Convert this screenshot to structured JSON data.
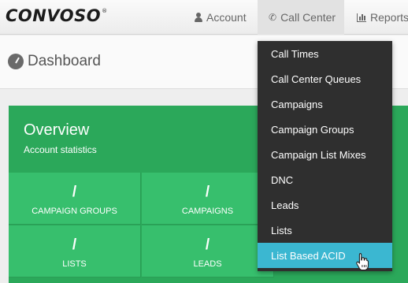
{
  "brand": {
    "logo": "CONVOSO",
    "mark": "®"
  },
  "nav": {
    "account": "Account",
    "call_center": "Call Center",
    "reports": "Reports"
  },
  "page": {
    "title": "Dashboard"
  },
  "overview": {
    "title": "Overview",
    "subtitle": "Account statistics",
    "tiles": [
      {
        "value": "/",
        "label": "CAMPAIGN GROUPS"
      },
      {
        "value": "/",
        "label": "CAMPAIGNS"
      },
      {
        "value": "/",
        "label": "LISTS"
      },
      {
        "value": "/",
        "label": "LEADS"
      }
    ]
  },
  "dropdown": {
    "items": [
      "Call Times",
      "Call Center Queues",
      "Campaigns",
      "Campaign Groups",
      "Campaign List Mixes",
      "DNC",
      "Leads",
      "Lists",
      "List Based ACID"
    ],
    "hovered_index": 8
  },
  "colors": {
    "panel_green": "#2ba85a",
    "tile_green": "#37bf6d",
    "menu_dark": "#2f2f2f",
    "menu_hover": "#3bb7d1"
  },
  "icons": {
    "account": "user-icon",
    "call_center": "phone-icon",
    "reports": "bar-chart-icon",
    "dashboard": "dashboard-gauge-icon",
    "pointer": "hand-pointer-cursor"
  }
}
